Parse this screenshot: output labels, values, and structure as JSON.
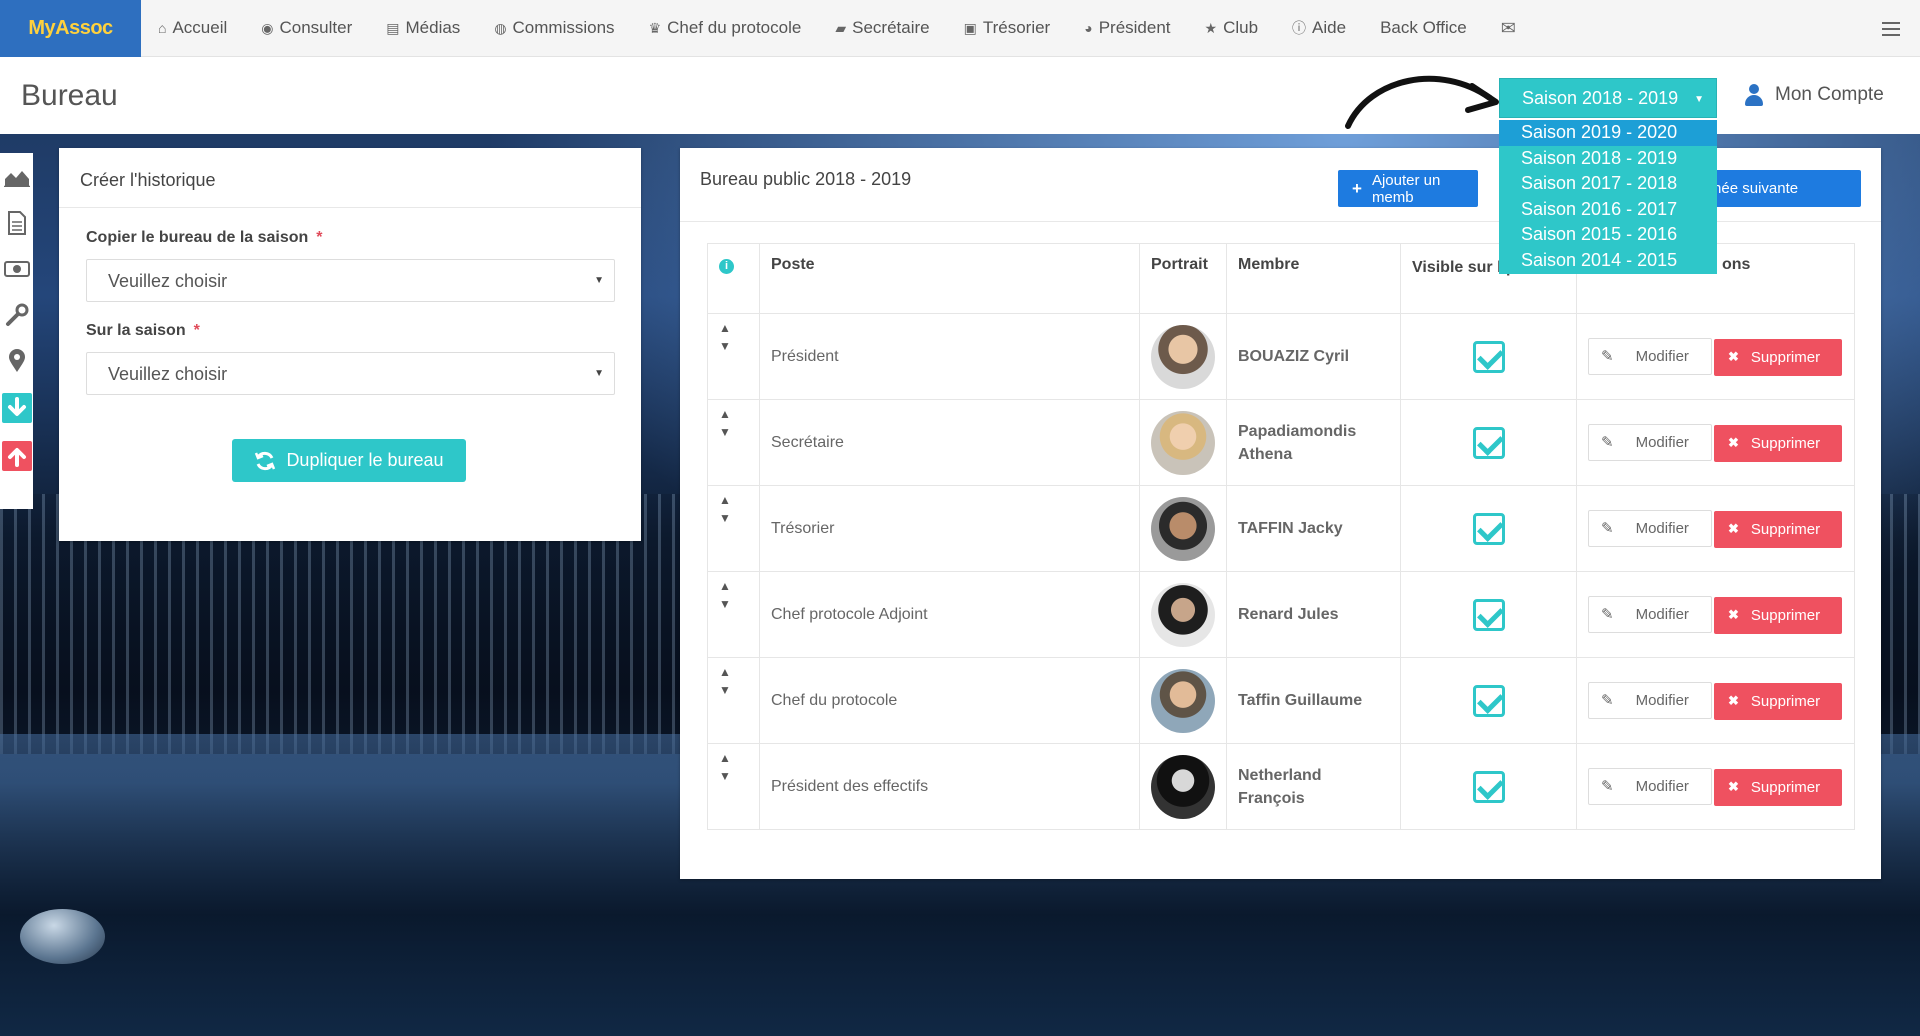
{
  "brand": "MyAssoc",
  "nav": [
    {
      "icon": "home-icon",
      "glyph": "⌂",
      "label": "Accueil"
    },
    {
      "icon": "eye-icon",
      "glyph": "◉",
      "label": "Consulter"
    },
    {
      "icon": "file-icon",
      "glyph": "▤",
      "label": "Médias"
    },
    {
      "icon": "user-circle-icon",
      "glyph": "◍",
      "label": "Commissions"
    },
    {
      "icon": "trophy-icon",
      "glyph": "♛",
      "label": "Chef du protocole"
    },
    {
      "icon": "book-icon",
      "glyph": "▰",
      "label": "Secrétaire"
    },
    {
      "icon": "money-icon",
      "glyph": "▣",
      "label": "Trésorier"
    },
    {
      "icon": "globe-icon",
      "glyph": "◕",
      "label": "Président"
    },
    {
      "icon": "star-icon",
      "glyph": "★",
      "label": "Club"
    },
    {
      "icon": "info-icon",
      "glyph": "ⓘ",
      "label": "Aide"
    },
    {
      "icon": "",
      "glyph": "",
      "label": "Back Office"
    },
    {
      "icon": "envelope-icon",
      "glyph": "✉",
      "label": ""
    }
  ],
  "page_title": "Bureau",
  "season": {
    "selected": "Saison 2018 - 2019",
    "options": [
      "Saison 2019 - 2020",
      "Saison 2018 - 2019",
      "Saison 2017 - 2018",
      "Saison 2016 - 2017",
      "Saison 2015 - 2016",
      "Saison 2014 - 2015"
    ],
    "highlighted_index": 0
  },
  "account_label": "Mon Compte",
  "left_card": {
    "title": "Créer l'historique",
    "copy_label": "Copier le bureau de la saison",
    "copy_value": "Veuillez choisir",
    "target_label": "Sur la saison",
    "target_value": "Veuillez choisir",
    "required_mark": "*",
    "duplicate_button": "Dupliquer le bureau"
  },
  "right_card": {
    "title": "Bureau public  2018 - 2019",
    "add_button": "Ajouter un memb",
    "next_button": "r l'année suivante",
    "columns": {
      "info": "i",
      "poste": "Poste",
      "portrait": "Portrait",
      "membre": "Membre",
      "visible": "Visible sur l public",
      "actions": "ons"
    },
    "rows": [
      {
        "poste": "Président",
        "membre": "BOUAZIZ Cyril",
        "visible": true
      },
      {
        "poste": "Secrétaire",
        "membre": "Papadiamondis Athena",
        "visible": true
      },
      {
        "poste": "Trésorier",
        "membre": "TAFFIN Jacky",
        "visible": true
      },
      {
        "poste": "Chef protocole Adjoint",
        "membre": "Renard Jules",
        "visible": true
      },
      {
        "poste": "Chef du protocole",
        "membre": "Taffin Guillaume",
        "visible": true
      },
      {
        "poste": "Président des effectifs",
        "membre": "Netherland François",
        "visible": true
      }
    ],
    "modify_label": "Modifier",
    "delete_label": "Supprimer"
  },
  "colors": {
    "brand_bg": "#2e6fbf",
    "brand_text": "#ffd13d",
    "teal": "#2ec7c9",
    "blue_button": "#1e7be0",
    "danger": "#ef5160"
  }
}
